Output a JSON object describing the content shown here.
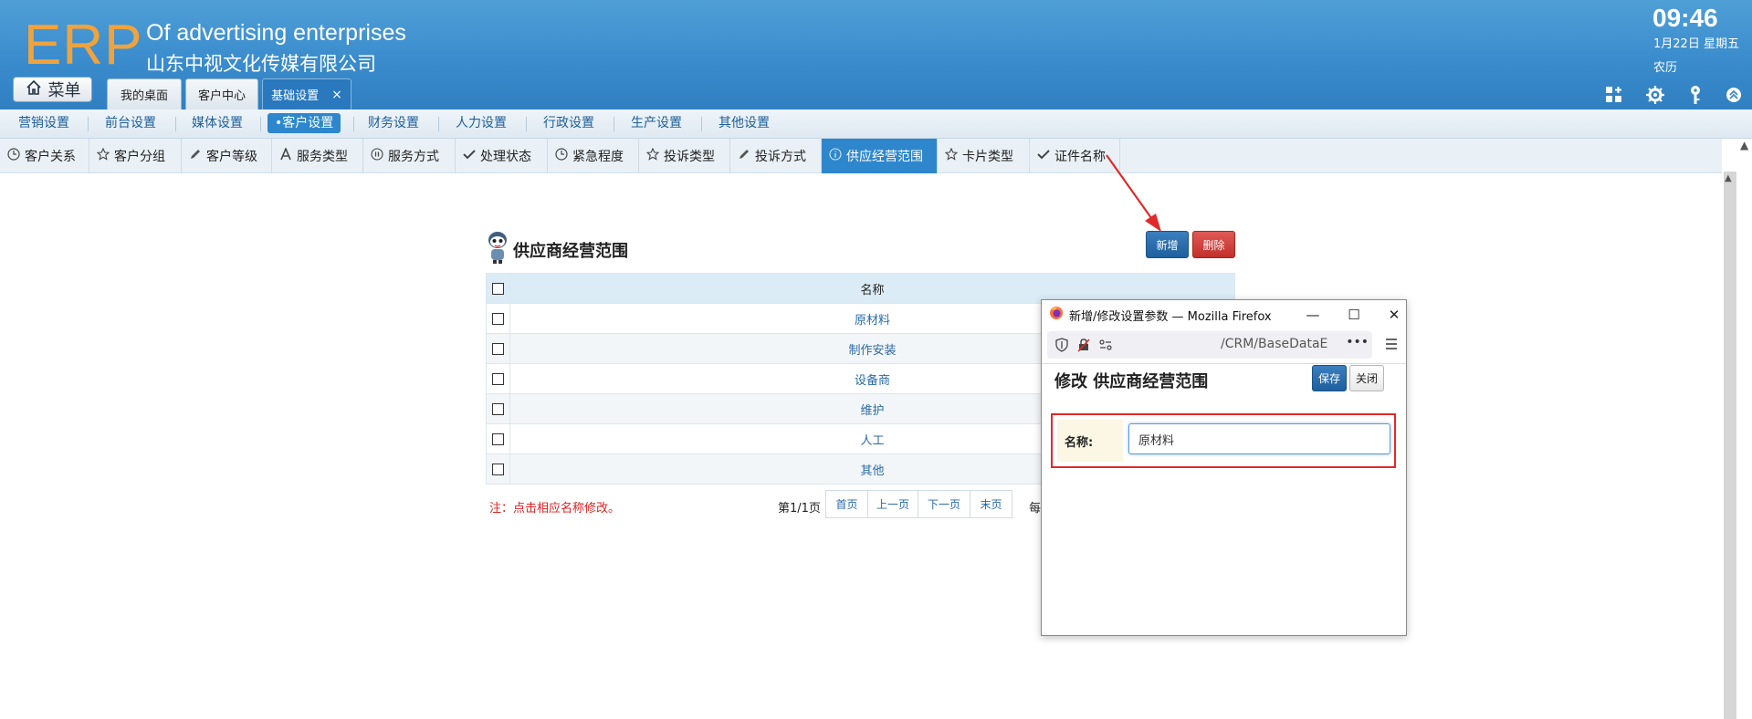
{
  "header": {
    "logo": "ERP",
    "brand_en": "Of advertising enterprises",
    "brand_cn": "山东中视文化传媒有限公司",
    "menu_label": "菜单",
    "tabs": [
      {
        "label": "我的桌面"
      },
      {
        "label": "客户中心"
      },
      {
        "label": "基础设置",
        "close": "×"
      }
    ],
    "clock": "09:46",
    "date": "1月22日 星期五",
    "lunar": "农历",
    "icons": [
      "grid-add-icon",
      "gear-icon",
      "key-icon",
      "chevron-up-circle-icon"
    ]
  },
  "categories": [
    "营销设置",
    "前台设置",
    "媒体设置",
    "•客户设置",
    "财务设置",
    "人力设置",
    "行政设置",
    "生产设置",
    "其他设置"
  ],
  "active_category": "•客户设置",
  "subtabs": [
    {
      "label": "客户关系",
      "icon": "clock-icon"
    },
    {
      "label": "客户分组",
      "icon": "star-icon"
    },
    {
      "label": "客户等级",
      "icon": "pencil-icon"
    },
    {
      "label": "服务类型",
      "icon": "letter-a-icon"
    },
    {
      "label": "服务方式",
      "icon": "pause-circle-icon"
    },
    {
      "label": "处理状态",
      "icon": "check-icon"
    },
    {
      "label": "紧急程度",
      "icon": "clock-icon"
    },
    {
      "label": "投诉类型",
      "icon": "star-icon"
    },
    {
      "label": "投诉方式",
      "icon": "pencil-icon"
    },
    {
      "label": "供应经营范围",
      "icon": "info-circle-icon",
      "active": true
    },
    {
      "label": "卡片类型",
      "icon": "star-icon"
    },
    {
      "label": "证件名称",
      "icon": "check-icon"
    }
  ],
  "panel": {
    "title": "供应商经营范围",
    "add_label": "新增",
    "delete_label": "删除",
    "column_name": "名称",
    "rows": [
      "原材料",
      "制作安装",
      "设备商",
      "维护",
      "人工",
      "其他"
    ],
    "note": "注：点击相应名称修改。",
    "pager": {
      "label": "第1/1页",
      "first": "首页",
      "prev": "上一页",
      "next": "下一页",
      "last": "末页",
      "per_page": "每"
    }
  },
  "popup": {
    "window_title": "新增/修改设置参数 — Mozilla Firefox",
    "url": "/CRM/BaseDataE",
    "more": "•••",
    "heading": "修改 供应商经营范围",
    "save_label": "保存",
    "close_label": "关闭",
    "field_label": "名称:",
    "field_value": "原材料"
  },
  "colors": {
    "header_blue": "#3a8ccd",
    "logo_orange": "#f0a33d",
    "active_blue": "#2e87cc",
    "annotation_red": "#e02a2a",
    "delete_red": "#c3302b"
  }
}
